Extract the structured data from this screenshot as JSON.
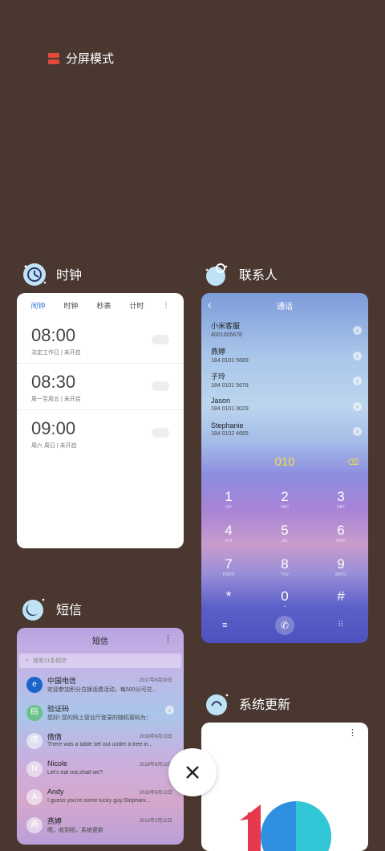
{
  "split_mode_label": "分屏模式",
  "apps": {
    "clock": {
      "title": "时钟",
      "tabs": [
        "闹钟",
        "时钟",
        "秒表",
        "计时"
      ],
      "active_tab": "闹钟",
      "alarms": [
        {
          "time": "08:00",
          "sub": "法定工作日 | 未开启",
          "enabled": false
        },
        {
          "time": "08:30",
          "sub": "周一至周五 | 未开启",
          "enabled": false
        },
        {
          "time": "09:00",
          "sub": "周六 周日 | 未开启",
          "enabled": false
        }
      ]
    },
    "contacts": {
      "title": "联系人",
      "tab_title": "通话",
      "list": [
        {
          "name": "小米客服",
          "phone": "4001005678"
        },
        {
          "name": "燕婷",
          "phone": "184 0101 5689"
        },
        {
          "name": "子玲",
          "phone": "184 0101 5678"
        },
        {
          "name": "Jason",
          "phone": "184 0101 0029"
        },
        {
          "name": "Stephanie",
          "phone": "184 0102 4685"
        }
      ],
      "dial_input": "010",
      "keys": [
        {
          "d": "1",
          "l": "GD"
        },
        {
          "d": "2",
          "l": "ABC"
        },
        {
          "d": "3",
          "l": "DEF"
        },
        {
          "d": "4",
          "l": "GHI"
        },
        {
          "d": "5",
          "l": "JKL"
        },
        {
          "d": "6",
          "l": "MNO"
        },
        {
          "d": "7",
          "l": "PQRS"
        },
        {
          "d": "8",
          "l": "TUV"
        },
        {
          "d": "9",
          "l": "WXYZ"
        },
        {
          "d": "*",
          "l": ""
        },
        {
          "d": "0",
          "l": "+"
        },
        {
          "d": "#",
          "l": ""
        }
      ]
    },
    "messages": {
      "title": "短信",
      "tab_title": "短信",
      "search_placeholder": "搜索11条短信",
      "threads": [
        {
          "avatar": "",
          "name": "中国电信",
          "text": "欢迎参加积分兑换话费活动，每500分可兑...",
          "date": "2017年6月30日"
        },
        {
          "avatar": "码",
          "name": "验证码",
          "text": "您好! 您的网上营业厅登录的随机密码为：",
          "date": ""
        },
        {
          "avatar": "倩",
          "name": "倩倩",
          "text": "There was a table set out under a tree in...",
          "date": "2018年6月13日"
        },
        {
          "avatar": "N",
          "name": "Nicole",
          "text": "Let's eat out,shall we?",
          "date": "2018年6月13日"
        },
        {
          "avatar": "A",
          "name": "Andy",
          "text": "I guess you're some lucky guy.Stephani...",
          "date": "2018年6月13日"
        },
        {
          "avatar": "燕",
          "name": "燕婷",
          "text": "嗯，收到啦，系统更新",
          "date": "2013年2月22日"
        }
      ]
    },
    "update": {
      "title": "系统更新"
    }
  },
  "colors": {
    "background": "#4a3830",
    "accent": "#3a7ae0",
    "dial_input": "#f0e040",
    "split_icon": "#e04a3a"
  }
}
